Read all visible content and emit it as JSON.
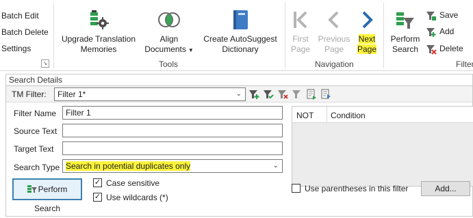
{
  "ribbon": {
    "batch": {
      "batch_edit": "Batch Edit",
      "batch_delete": "Batch Delete",
      "settings": "Settings"
    },
    "tools": {
      "upgrade_line1": "Upgrade Translation",
      "upgrade_line2": "Memories",
      "align_line1": "Align",
      "align_line2": "Documents",
      "create_line1": "Create AutoSuggest",
      "create_line2": "Dictionary",
      "group_label": "Tools"
    },
    "navigation": {
      "first_line1": "First",
      "first_line2": "Page",
      "previous_line1": "Previous",
      "previous_line2": "Page",
      "next_line1": "Next",
      "next_line2": "Page",
      "group_label": "Navigation"
    },
    "filter": {
      "perform_line1": "Perform",
      "perform_line2": "Search",
      "save": "Save",
      "add": "Add",
      "delete": "Delete",
      "group_label_partial": "Filter"
    }
  },
  "search_details": {
    "title": "Search Details",
    "tm_filter_label": "TM Filter:",
    "tm_filter_value": "Filter 1*",
    "fields": {
      "filter_name_label": "Filter Name",
      "filter_name_value": "Filter 1",
      "source_text_label": "Source Text",
      "source_text_value": "",
      "target_text_label": "Target Text",
      "target_text_value": "",
      "search_type_label": "Search Type",
      "search_type_value": "Search in potential duplicates only"
    },
    "perform_search_button": "Perform Search",
    "case_sensitive": {
      "label": "Case sensitive",
      "checked": true
    },
    "use_wildcards": {
      "label": "Use wildcards (*)",
      "checked": true
    },
    "conditions": {
      "col_not": "NOT",
      "col_condition": "Condition"
    },
    "use_parentheses": {
      "label": "Use parentheses in this filter",
      "checked": false
    },
    "add_button": "Add..."
  },
  "colors": {
    "highlight": "#fbf33a",
    "nav_active": "#2b6cb0",
    "nav_disabled": "#b5b5b5",
    "dict_blue": "#3d7cc4",
    "icon_green": "#2e9e4e"
  }
}
